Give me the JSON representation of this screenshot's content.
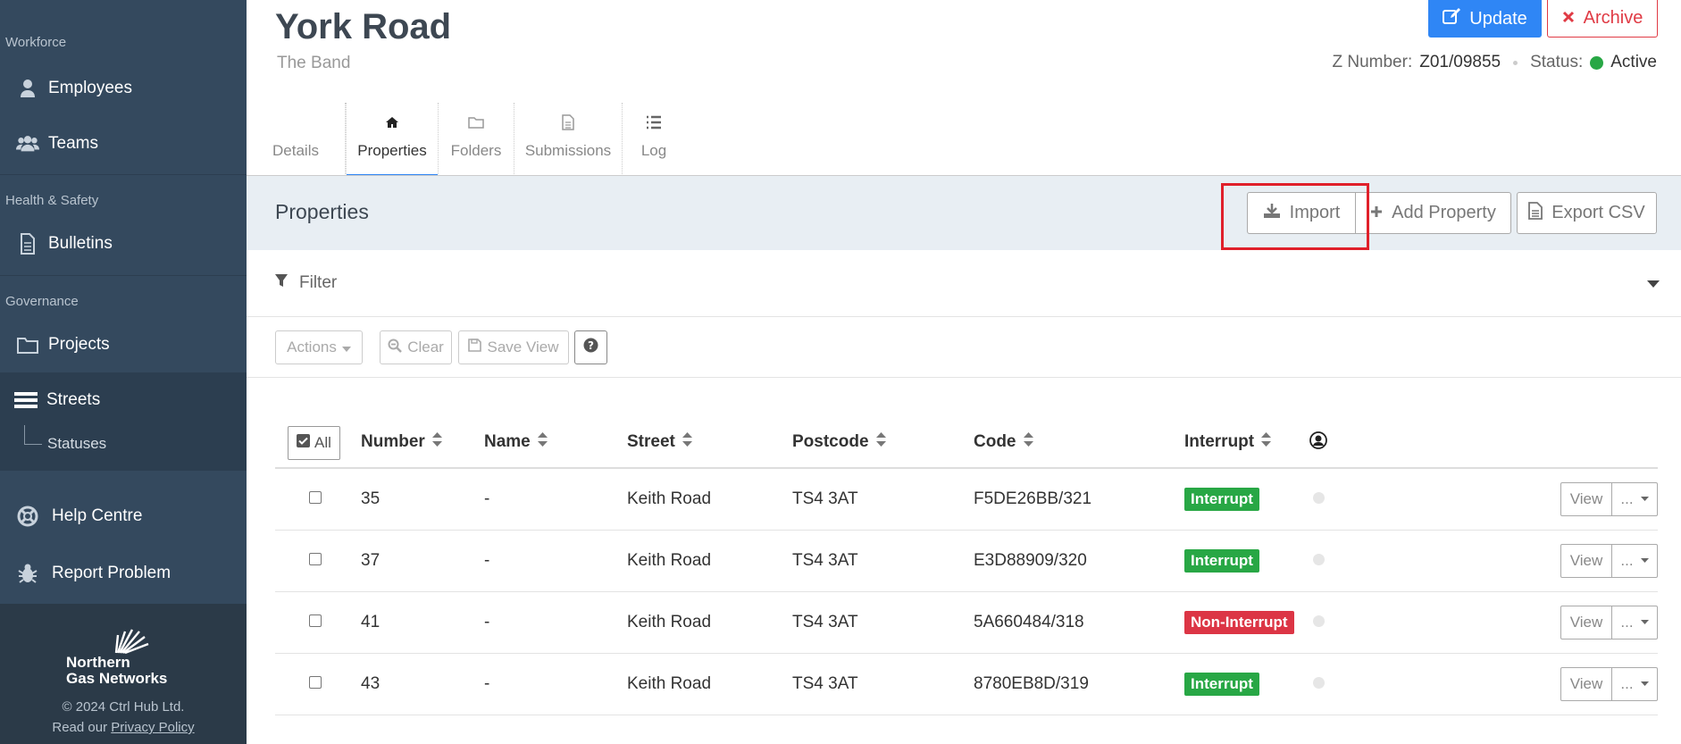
{
  "sidebar": {
    "section_workforce": "Workforce",
    "employees": "Employees",
    "teams": "Teams",
    "section_hs": "Health & Safety",
    "bulletins": "Bulletins",
    "section_governance": "Governance",
    "projects": "Projects",
    "streets": "Streets",
    "statuses": "Statuses",
    "help_centre": "Help Centre",
    "report_problem": "Report Problem",
    "logo_line1": "Northern",
    "logo_line2": "Gas Networks",
    "copyright": "© 2024 Ctrl Hub Ltd.",
    "read_our": "Read our",
    "privacy_policy": "Privacy Policy"
  },
  "header": {
    "title": "York Road",
    "subtitle": "The Band",
    "update_label": "Update",
    "archive_label": "Archive",
    "z_number_label": "Z Number:",
    "z_number_value": "Z01/09855",
    "status_label": "Status:",
    "status_value": "Active",
    "status_color": "#28a745"
  },
  "tabs": [
    {
      "label": "Details",
      "icon": "none"
    },
    {
      "label": "Properties",
      "icon": "home-icon"
    },
    {
      "label": "Folders",
      "icon": "folder-icon"
    },
    {
      "label": "Submissions",
      "icon": "document-icon"
    },
    {
      "label": "Log",
      "icon": "list-icon"
    }
  ],
  "panel": {
    "title": "Properties",
    "import_label": "Import",
    "add_property_label": "Add Property",
    "export_csv_label": "Export CSV"
  },
  "filter": {
    "label": "Filter"
  },
  "toolbar": {
    "actions_label": "Actions",
    "clear_label": "Clear",
    "save_view_label": "Save View"
  },
  "table": {
    "all_label": "All",
    "columns": [
      "Number",
      "Name",
      "Street",
      "Postcode",
      "Code",
      "Interrupt"
    ],
    "rows": [
      {
        "number": "35",
        "name": "-",
        "street": "Keith Road",
        "postcode": "TS4 3AT",
        "code": "F5DE26BB/321",
        "interrupt": "Interrupt"
      },
      {
        "number": "37",
        "name": "-",
        "street": "Keith Road",
        "postcode": "TS4 3AT",
        "code": "E3D88909/320",
        "interrupt": "Interrupt"
      },
      {
        "number": "41",
        "name": "-",
        "street": "Keith Road",
        "postcode": "TS4 3AT",
        "code": "5A660484/318",
        "interrupt": "Non-Interrupt"
      },
      {
        "number": "43",
        "name": "-",
        "street": "Keith Road",
        "postcode": "TS4 3AT",
        "code": "8780EB8D/319",
        "interrupt": "Interrupt"
      }
    ],
    "view_label": "View",
    "more_label": "..."
  },
  "colors": {
    "accent": "#2f86f5",
    "danger": "#e03b45",
    "sidebar_bg": "#34495e",
    "interrupt": "#28a745",
    "non_interrupt": "#dc3545"
  }
}
